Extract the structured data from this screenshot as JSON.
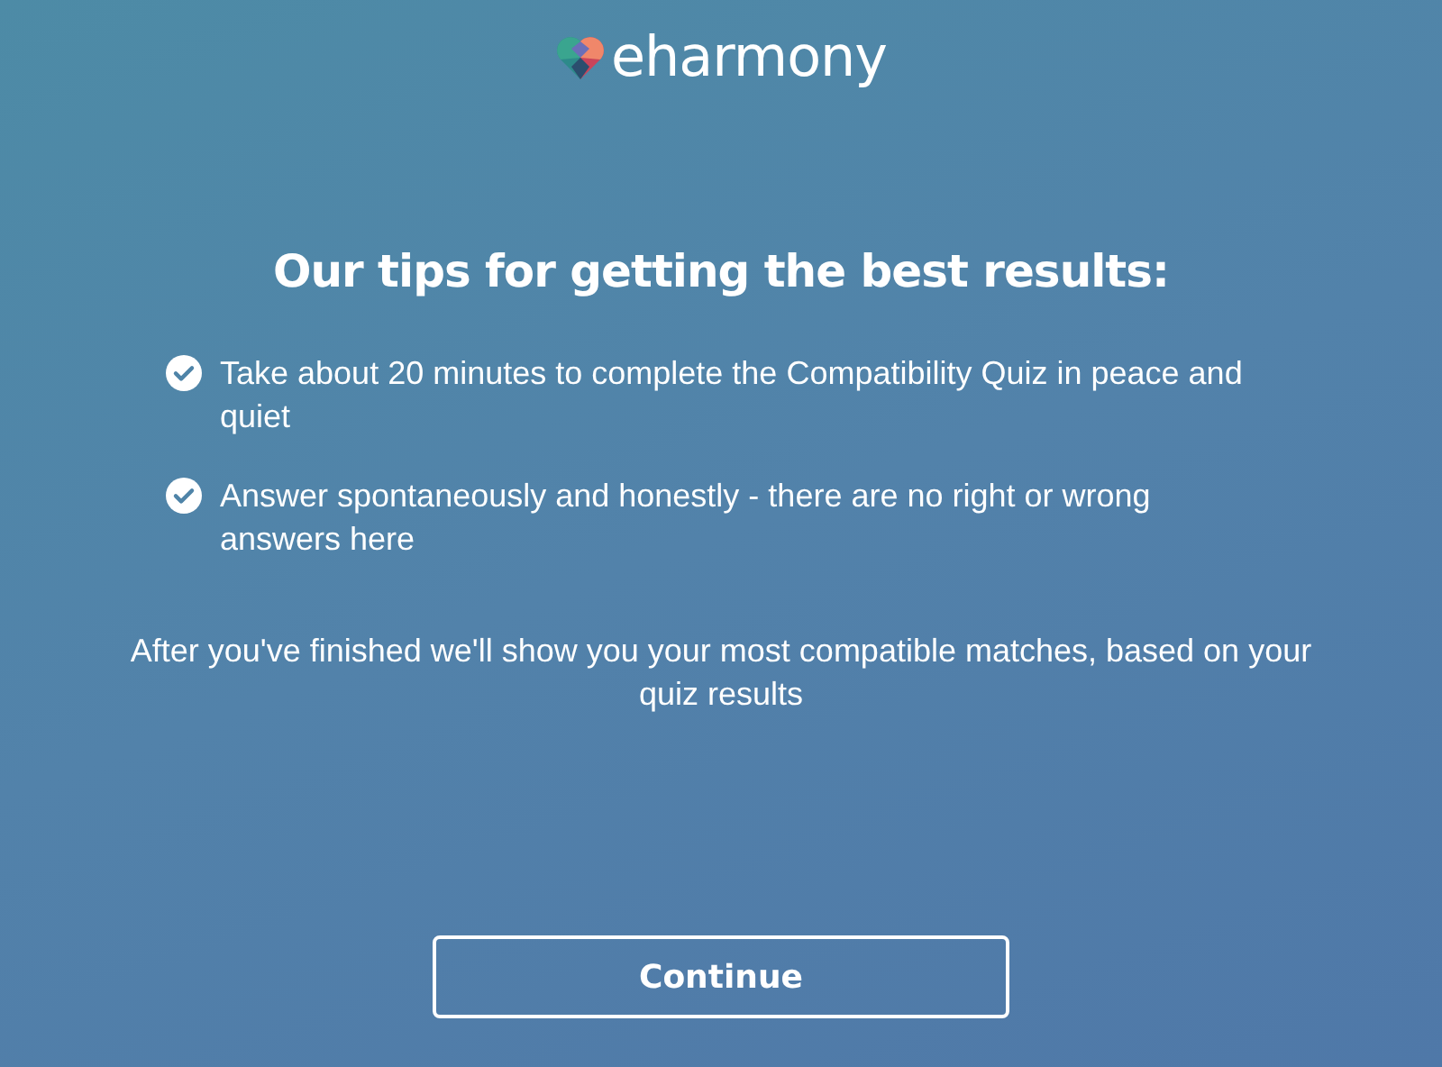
{
  "logo": {
    "text": "eharmony"
  },
  "title": "Our tips for getting the best results:",
  "tips": [
    {
      "text": "Take about 20 minutes to complete the Compatibility Quiz in peace and quiet"
    },
    {
      "text": "Answer spontaneously and honestly - there are no right or wrong answers here"
    }
  ],
  "note": "After you've finished we'll show you your most compatible matches, based on your quiz results",
  "button": {
    "label": "Continue"
  }
}
